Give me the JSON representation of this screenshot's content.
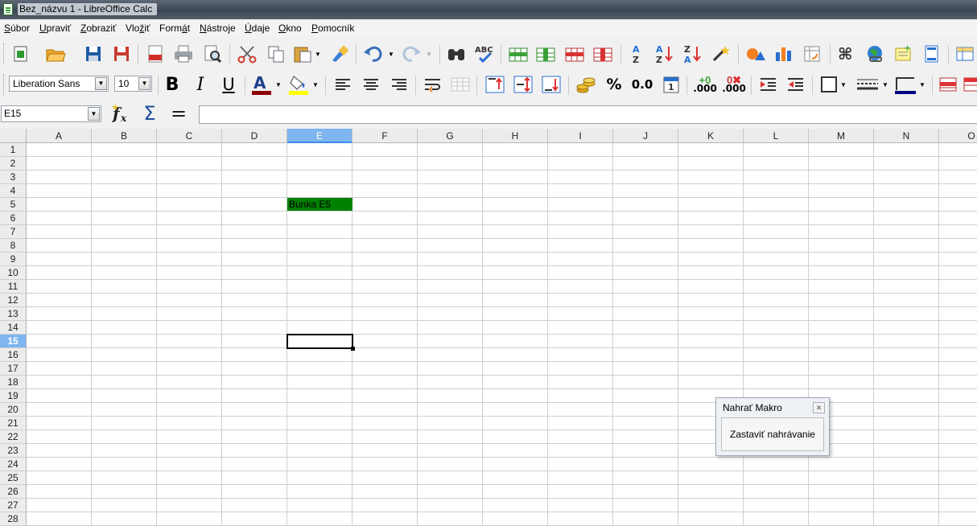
{
  "window": {
    "title": "Bez_názvu 1 - LibreOffice Calc"
  },
  "menu": [
    {
      "pre": "",
      "u": "S",
      "post": "úbor"
    },
    {
      "pre": "",
      "u": "U",
      "post": "praviť"
    },
    {
      "pre": "",
      "u": "Z",
      "post": "obraziť"
    },
    {
      "pre": "Vlo",
      "u": "ž",
      "post": "iť"
    },
    {
      "pre": "Form",
      "u": "á",
      "post": "t"
    },
    {
      "pre": "",
      "u": "N",
      "post": "ástroje"
    },
    {
      "pre": "",
      "u": "Ú",
      "post": "daje"
    },
    {
      "pre": "",
      "u": "O",
      "post": "kno"
    },
    {
      "pre": "",
      "u": "P",
      "post": "omocník"
    }
  ],
  "format": {
    "font_name": "Liberation Sans",
    "font_size": "10",
    "bold": "B",
    "italic": "I",
    "underline": "U",
    "percent": "%",
    "decimal": "0.0",
    "add_decimal": ".000",
    "del_decimal": ".000"
  },
  "formula": {
    "cell_ref": "E15",
    "sum": "Σ",
    "equals": "="
  },
  "sheet": {
    "columns": [
      "A",
      "B",
      "C",
      "D",
      "E",
      "F",
      "G",
      "H",
      "I",
      "J",
      "K",
      "L",
      "M",
      "N",
      "O"
    ],
    "rows": [
      "1",
      "2",
      "3",
      "4",
      "5",
      "6",
      "7",
      "8",
      "9",
      "10",
      "11",
      "12",
      "13",
      "14",
      "15",
      "16",
      "17",
      "18",
      "19",
      "20",
      "21",
      "22",
      "23",
      "24",
      "25",
      "26",
      "27",
      "28"
    ],
    "selected_column": "E",
    "selected_row": "15",
    "cell_e5": "Bunka E5",
    "cell_e5_color": "#008000"
  },
  "macro_dialog": {
    "title": "Nahrať Makro",
    "stop_button": "Zastaviť nahrávanie"
  }
}
